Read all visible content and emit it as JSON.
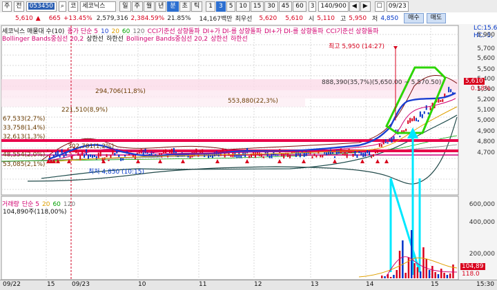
{
  "toolbar": {
    "market": "주",
    "prev": "전",
    "code": "053450",
    "exchange": "코",
    "name": "세코닉스",
    "periods": [
      "일",
      "주",
      "월",
      "년",
      "분",
      "초",
      "틱"
    ],
    "active_period": "분",
    "intervals": [
      "1",
      "3",
      "5",
      "10",
      "15",
      "30",
      "45",
      "60"
    ],
    "active_interval": "3",
    "count": "3",
    "range": "140/900",
    "nav": [
      "◀",
      "▶"
    ],
    "date": "09/23"
  },
  "quote": {
    "price": "5,610",
    "arrow": "▲",
    "change": "665",
    "rate": "+13.45%",
    "volume": "2,579,316",
    "vol_rate": "2,384.59%",
    "turnover": "21.85%",
    "amount": "14,167백만",
    "best_ask_label": "최우선",
    "ask": "5,620",
    "bid": "5,610",
    "open_label": "시",
    "open": "5,110",
    "high_label": "고",
    "high": "5,950",
    "low_label": "저",
    "low": "4,850",
    "buy": "매수",
    "sell": "매도"
  },
  "legend": {
    "l1": [
      {
        "t": "세코닉스 매물대 수(10)",
        "c": "#111"
      },
      {
        "t": "종가 단순 5",
        "c": "#d0006f"
      },
      {
        "t": "10",
        "c": "#1a3fd0"
      },
      {
        "t": "20",
        "c": "#e0a000"
      },
      {
        "t": "60",
        "c": "#00a000"
      },
      {
        "t": "120",
        "c": "#777"
      },
      {
        "t": "CCI기준선 상향돌파",
        "c": "#d0006f"
      },
      {
        "t": "DI+가 DI-를 상향돌파",
        "c": "#d0006f"
      },
      {
        "t": "DI+가 DI-를 상향돌파",
        "c": "#d0006f"
      },
      {
        "t": "CCI기준선 상향돌파",
        "c": "#d0006f"
      }
    ],
    "l2": [
      {
        "t": "Bollinger Bands중심선 20,2",
        "c": "#d0006f"
      },
      {
        "t": "상한선",
        "c": "#111"
      },
      {
        "t": "하한선",
        "c": "#111"
      },
      {
        "t": "Bollinger Bands중심선 20,2",
        "c": "#d0006f"
      },
      {
        "t": "상한선",
        "c": "#d0006f"
      },
      {
        "t": "하한선",
        "c": "#d0006f"
      }
    ],
    "right_top": "LC:15.6",
    "right_bot": "HC:-5,"
  },
  "annotations": {
    "high": "최고 5,950 (14:27)",
    "low": "최저 4,850 (10:15)",
    "vp1": "888,390(35,7%)(5,650.00 ~ 5,570.50)",
    "vp2": "294,706(11,8%)",
    "vp3": "553,880(22,3%)",
    "vp4": "221,510(8,9%)",
    "vp5": "67,533(2,7%)",
    "vp6": "33,758(1,4%)",
    "vp7": "32,613(1,3%)",
    "vp8": "48,554(2,0%)",
    "vp9": "53,085(2,1%)",
    "vp10": "302,781(1,2%)",
    "price_tag": "5,610",
    "pct_tag": "0.18%"
  },
  "price_axis": [
    "5,900",
    "5,700",
    "5,600",
    "5,500",
    "5,400",
    "5,300",
    "5,200",
    "5,100",
    "5,000",
    "4,900",
    "4,800",
    "4,700"
  ],
  "volume_panel": {
    "legend": [
      {
        "t": "거래량",
        "c": "#d0006f"
      },
      {
        "t": "단순 5",
        "c": "#d0006f"
      },
      {
        "t": "20",
        "c": "#e0a000"
      },
      {
        "t": "60",
        "c": "#00a000"
      },
      {
        "t": "120",
        "c": "#777"
      }
    ],
    "value": "104,890주(118,00%)",
    "axis": [
      "600,000",
      "400,000",
      "200,000"
    ],
    "tag1": "104,89",
    "tag2": "118.0"
  },
  "time_axis": [
    "09/22",
    "15",
    "09/23",
    "10",
    "11",
    "12",
    "13",
    "14",
    "15",
    "15:30"
  ],
  "colors": {
    "up": "#d8001c",
    "down": "#0035c8",
    "cyan": "#00e8ff",
    "green": "#2cd500",
    "band": "#e8004a"
  }
}
